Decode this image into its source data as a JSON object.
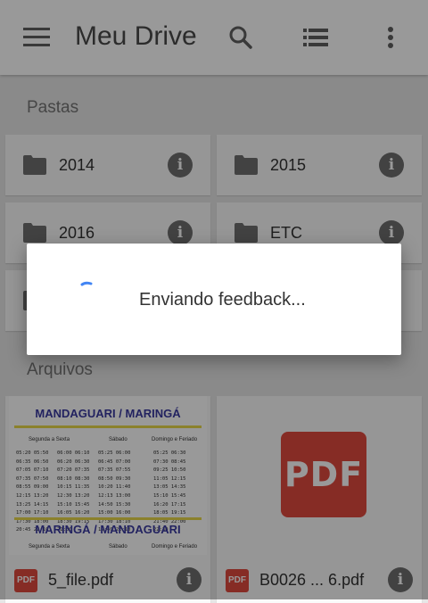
{
  "appbar": {
    "title": "Meu Drive"
  },
  "sections": {
    "folders_label": "Pastas",
    "files_label": "Arquivos"
  },
  "folders": [
    {
      "name": "2014"
    },
    {
      "name": "2015"
    },
    {
      "name": "2016"
    },
    {
      "name": "ETC"
    }
  ],
  "files": [
    {
      "name": "5_file.pdf",
      "type_badge": "PDF"
    },
    {
      "name": "B0026 ... 6.pdf",
      "type_badge": "PDF"
    }
  ],
  "thumbnail": {
    "title_top": "MANDAGUARI / MARINGÁ",
    "title_bottom": "MARINGÁ / MANDAGUARI",
    "header_weekday": "Segunda a Sexta",
    "header_saturday": "Sábado",
    "header_sunday": "Domingo e Feriado",
    "col1": "05:20 05:50\n06:35 06:50\n07:05 07:10\n07:35 07:50\n08:55 09:00\n12:15 13:20\n13:25 14:15\n17:00 17:10\n17:30 18:00\n20:45 22:10",
    "col2": "06:00 06:10\n06:20 06:30\n07:20 07:35\n08:10 08:30\n10:15 11:35\n12:30 13:20\n15:10 15:45\n16:05 16:20\n18:30 19:15\n22:30",
    "col3": "05:25 06:00\n06:45 07:00\n07:35 07:55\n08:50 09:30\n10:20 11:40\n12:13 13:00\n14:50 15:30\n15:00 16:00\n17:30 18:10\n19:40 22:10",
    "col4": "05:25 06:30\n07:30 08:45\n09:25 10:50\n11:05 12:15\n13:05 14:35\n15:10 15:45\n16:20 17:15\n18:05 19:15\n21:40 22:00\n22:30"
  },
  "dialog": {
    "message": "Enviando feedback..."
  },
  "colors": {
    "pdf_red": "#e04a3f",
    "spinner_blue": "#4285f4",
    "icon_gray": "#606060"
  }
}
